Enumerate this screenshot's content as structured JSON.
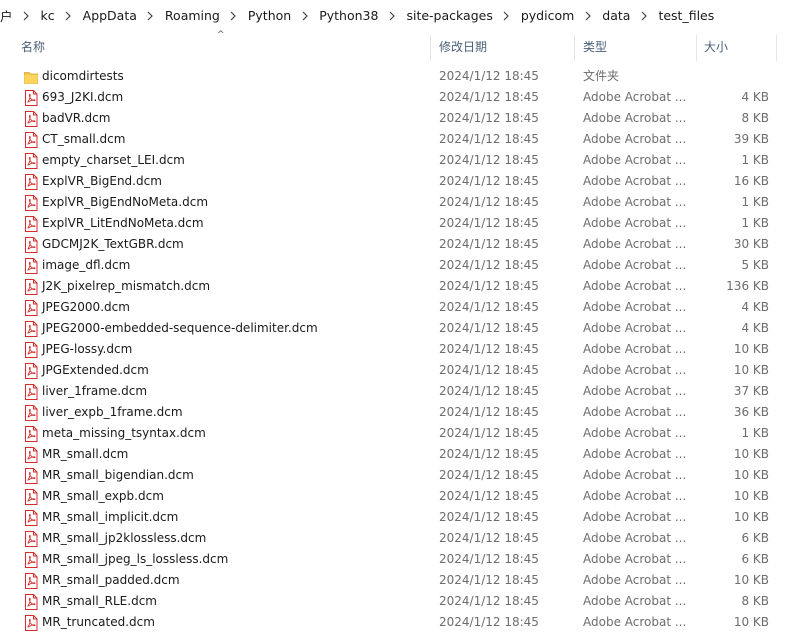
{
  "breadcrumb": [
    "户",
    "kc",
    "AppData",
    "Roaming",
    "Python",
    "Python38",
    "site-packages",
    "pydicom",
    "data",
    "test_files"
  ],
  "columns": {
    "name": "名称",
    "date": "修改日期",
    "type": "类型",
    "size": "大小"
  },
  "sort_indicator": "^",
  "rows": [
    {
      "name": "dicomdirtests",
      "date": "2024/1/12 18:45",
      "type": "文件夹",
      "size": "",
      "icon": "folder-icon"
    },
    {
      "name": "693_J2KI.dcm",
      "date": "2024/1/12 18:45",
      "type": "Adobe Acrobat ...",
      "size": "4 KB",
      "icon": "pdf-file-icon"
    },
    {
      "name": "badVR.dcm",
      "date": "2024/1/12 18:45",
      "type": "Adobe Acrobat ...",
      "size": "8 KB",
      "icon": "pdf-file-icon"
    },
    {
      "name": "CT_small.dcm",
      "date": "2024/1/12 18:45",
      "type": "Adobe Acrobat ...",
      "size": "39 KB",
      "icon": "pdf-file-icon"
    },
    {
      "name": "empty_charset_LEI.dcm",
      "date": "2024/1/12 18:45",
      "type": "Adobe Acrobat ...",
      "size": "1 KB",
      "icon": "pdf-file-icon"
    },
    {
      "name": "ExplVR_BigEnd.dcm",
      "date": "2024/1/12 18:45",
      "type": "Adobe Acrobat ...",
      "size": "16 KB",
      "icon": "pdf-file-icon"
    },
    {
      "name": "ExplVR_BigEndNoMeta.dcm",
      "date": "2024/1/12 18:45",
      "type": "Adobe Acrobat ...",
      "size": "1 KB",
      "icon": "pdf-file-icon"
    },
    {
      "name": "ExplVR_LitEndNoMeta.dcm",
      "date": "2024/1/12 18:45",
      "type": "Adobe Acrobat ...",
      "size": "1 KB",
      "icon": "pdf-file-icon"
    },
    {
      "name": "GDCMJ2K_TextGBR.dcm",
      "date": "2024/1/12 18:45",
      "type": "Adobe Acrobat ...",
      "size": "30 KB",
      "icon": "pdf-file-icon"
    },
    {
      "name": "image_dfl.dcm",
      "date": "2024/1/12 18:45",
      "type": "Adobe Acrobat ...",
      "size": "5 KB",
      "icon": "pdf-file-icon"
    },
    {
      "name": "J2K_pixelrep_mismatch.dcm",
      "date": "2024/1/12 18:45",
      "type": "Adobe Acrobat ...",
      "size": "136 KB",
      "icon": "pdf-file-icon"
    },
    {
      "name": "JPEG2000.dcm",
      "date": "2024/1/12 18:45",
      "type": "Adobe Acrobat ...",
      "size": "4 KB",
      "icon": "pdf-file-icon"
    },
    {
      "name": "JPEG2000-embedded-sequence-delimiter.dcm",
      "date": "2024/1/12 18:45",
      "type": "Adobe Acrobat ...",
      "size": "4 KB",
      "icon": "pdf-file-icon"
    },
    {
      "name": "JPEG-lossy.dcm",
      "date": "2024/1/12 18:45",
      "type": "Adobe Acrobat ...",
      "size": "10 KB",
      "icon": "pdf-file-icon"
    },
    {
      "name": "JPGExtended.dcm",
      "date": "2024/1/12 18:45",
      "type": "Adobe Acrobat ...",
      "size": "10 KB",
      "icon": "pdf-file-icon"
    },
    {
      "name": "liver_1frame.dcm",
      "date": "2024/1/12 18:45",
      "type": "Adobe Acrobat ...",
      "size": "37 KB",
      "icon": "pdf-file-icon"
    },
    {
      "name": "liver_expb_1frame.dcm",
      "date": "2024/1/12 18:45",
      "type": "Adobe Acrobat ...",
      "size": "36 KB",
      "icon": "pdf-file-icon"
    },
    {
      "name": "meta_missing_tsyntax.dcm",
      "date": "2024/1/12 18:45",
      "type": "Adobe Acrobat ...",
      "size": "1 KB",
      "icon": "pdf-file-icon"
    },
    {
      "name": "MR_small.dcm",
      "date": "2024/1/12 18:45",
      "type": "Adobe Acrobat ...",
      "size": "10 KB",
      "icon": "pdf-file-icon"
    },
    {
      "name": "MR_small_bigendian.dcm",
      "date": "2024/1/12 18:45",
      "type": "Adobe Acrobat ...",
      "size": "10 KB",
      "icon": "pdf-file-icon"
    },
    {
      "name": "MR_small_expb.dcm",
      "date": "2024/1/12 18:45",
      "type": "Adobe Acrobat ...",
      "size": "10 KB",
      "icon": "pdf-file-icon"
    },
    {
      "name": "MR_small_implicit.dcm",
      "date": "2024/1/12 18:45",
      "type": "Adobe Acrobat ...",
      "size": "10 KB",
      "icon": "pdf-file-icon"
    },
    {
      "name": "MR_small_jp2klossless.dcm",
      "date": "2024/1/12 18:45",
      "type": "Adobe Acrobat ...",
      "size": "6 KB",
      "icon": "pdf-file-icon"
    },
    {
      "name": "MR_small_jpeg_ls_lossless.dcm",
      "date": "2024/1/12 18:45",
      "type": "Adobe Acrobat ...",
      "size": "6 KB",
      "icon": "pdf-file-icon"
    },
    {
      "name": "MR_small_padded.dcm",
      "date": "2024/1/12 18:45",
      "type": "Adobe Acrobat ...",
      "size": "10 KB",
      "icon": "pdf-file-icon"
    },
    {
      "name": "MR_small_RLE.dcm",
      "date": "2024/1/12 18:45",
      "type": "Adobe Acrobat ...",
      "size": "8 KB",
      "icon": "pdf-file-icon"
    },
    {
      "name": "MR_truncated.dcm",
      "date": "2024/1/12 18:45",
      "type": "Adobe Acrobat ...",
      "size": "10 KB",
      "icon": "pdf-file-icon"
    }
  ],
  "colors": {
    "folder": "#f5c64a",
    "pdf_red": "#d62b2b",
    "header_text": "#4c607a",
    "muted_text": "#6d6d6d"
  }
}
